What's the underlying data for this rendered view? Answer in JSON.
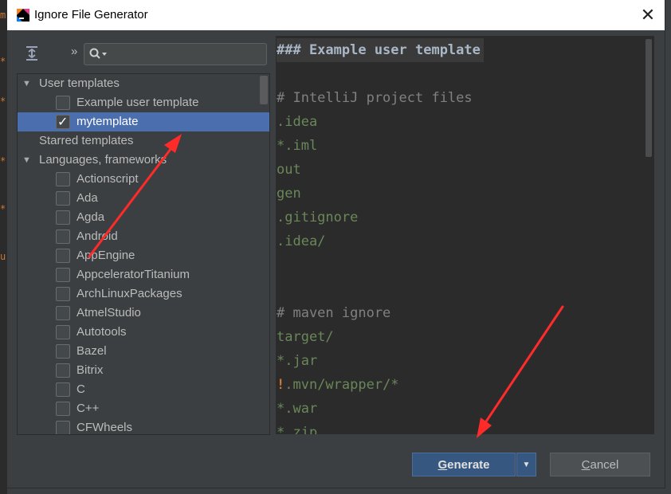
{
  "window": {
    "title": "Ignore File Generator",
    "close_glyph": "✕"
  },
  "toolbar": {
    "more_glyph": "»",
    "search_placeholder": ""
  },
  "tree": {
    "groups": [
      {
        "label": "User templates",
        "items": [
          {
            "label": "Example user template",
            "checked": false
          },
          {
            "label": "mytemplate",
            "checked": true,
            "selected": true
          }
        ]
      },
      {
        "label": "Starred templates",
        "items": []
      },
      {
        "label": "Languages, frameworks",
        "items": [
          {
            "label": "Actionscript",
            "checked": false
          },
          {
            "label": "Ada",
            "checked": false
          },
          {
            "label": "Agda",
            "checked": false
          },
          {
            "label": "Android",
            "checked": false
          },
          {
            "label": "AppEngine",
            "checked": false
          },
          {
            "label": "AppceleratorTitanium",
            "checked": false
          },
          {
            "label": "ArchLinuxPackages",
            "checked": false
          },
          {
            "label": "AtmelStudio",
            "checked": false
          },
          {
            "label": "Autotools",
            "checked": false
          },
          {
            "label": "Bazel",
            "checked": false
          },
          {
            "label": "Bitrix",
            "checked": false
          },
          {
            "label": "C",
            "checked": false
          },
          {
            "label": "C++",
            "checked": false
          },
          {
            "label": "CFWheels",
            "checked": false
          }
        ]
      }
    ]
  },
  "editor": {
    "lines": [
      {
        "text": "### Example user template",
        "kind": "heading"
      },
      {
        "text": "",
        "kind": "blank"
      },
      {
        "text": "# IntelliJ project files",
        "kind": "comment"
      },
      {
        "text": ".idea",
        "kind": "path"
      },
      {
        "text": "*.iml",
        "kind": "path"
      },
      {
        "text": "out",
        "kind": "path"
      },
      {
        "text": "gen",
        "kind": "path"
      },
      {
        "text": ".gitignore",
        "kind": "path"
      },
      {
        "text": ".idea/",
        "kind": "path"
      },
      {
        "text": "",
        "kind": "blank"
      },
      {
        "text": "",
        "kind": "blank"
      },
      {
        "text": "# maven ignore",
        "kind": "comment"
      },
      {
        "text": "target/",
        "kind": "path"
      },
      {
        "text": "*.jar",
        "kind": "path"
      },
      {
        "text": ".mvn/wrapper/*",
        "kind": "negated",
        "prefix": "!"
      },
      {
        "text": "*.war",
        "kind": "path"
      },
      {
        "text": "*.zip",
        "kind": "path"
      }
    ]
  },
  "buttons": {
    "generate": {
      "mnemonic": "G",
      "rest": "enerate"
    },
    "generate_dropdown_glyph": "▼",
    "cancel": {
      "mnemonic": "C",
      "rest": "ancel"
    }
  },
  "colors": {
    "selection": "#4b6eaf",
    "annotation_arrow": "#ff2a2a",
    "path_text": "#6a8759",
    "comment_text": "#808080"
  },
  "icons": [
    "app-icon",
    "expand-all-icon",
    "search-icon",
    "close-icon",
    "checkbox-icon",
    "chevron-down-icon"
  ]
}
